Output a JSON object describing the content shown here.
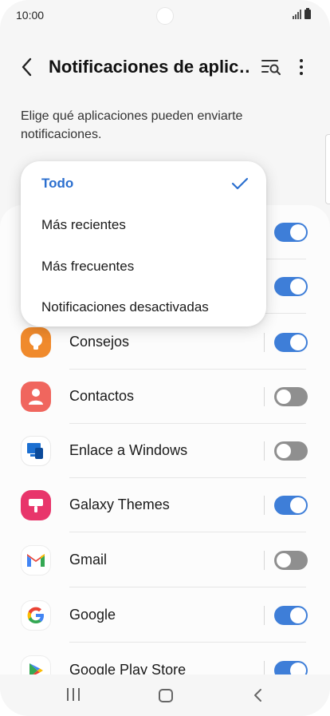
{
  "status_bar": {
    "time": "10:00"
  },
  "header": {
    "title": "Notificaciones de aplic…",
    "back_icon": "back-arrow-icon",
    "search_icon": "search-filter-icon",
    "more_icon": "more-vertical-icon"
  },
  "description": "Elige qué aplicaciones pueden enviarte notificaciones.",
  "dropdown": {
    "items": [
      {
        "label": "Todo",
        "selected": true
      },
      {
        "label": "Más recientes",
        "selected": false
      },
      {
        "label": "Más frecuentes",
        "selected": false
      },
      {
        "label": "Notificaciones desactivadas",
        "selected": false
      }
    ]
  },
  "apps": [
    {
      "name": "",
      "enabled": true
    },
    {
      "name": "",
      "enabled": true
    },
    {
      "name": "Consejos",
      "icon": "tips-lightbulb-icon",
      "enabled": true
    },
    {
      "name": "Contactos",
      "icon": "contacts-icon",
      "enabled": false
    },
    {
      "name": "Enlace a Windows",
      "icon": "link-to-windows-icon",
      "enabled": false
    },
    {
      "name": "Galaxy Themes",
      "icon": "galaxy-themes-icon",
      "enabled": true
    },
    {
      "name": "Gmail",
      "icon": "gmail-icon",
      "enabled": false
    },
    {
      "name": "Google",
      "icon": "google-icon",
      "enabled": true
    },
    {
      "name": "Google Play Store",
      "icon": "google-play-store-icon",
      "enabled": true
    }
  ],
  "colors": {
    "accent": "#3e7ed8",
    "toggle_off": "#8f8f8f",
    "selected_text": "#2b6fcf"
  }
}
